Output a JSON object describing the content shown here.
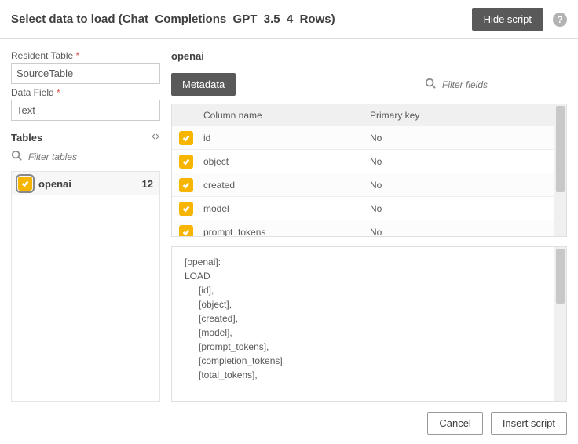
{
  "header": {
    "title": "Select data to load (Chat_Completions_GPT_3.5_4_Rows)",
    "hide_script_btn": "Hide script"
  },
  "left": {
    "resident_label": "Resident Table",
    "resident_value": "SourceTable",
    "datafield_label": "Data Field",
    "datafield_value": "Text",
    "tables_header": "Tables",
    "filter_placeholder": "Filter tables",
    "tables": [
      {
        "name": "openai",
        "count": "12",
        "selected": true
      }
    ]
  },
  "right": {
    "selected_table": "openai",
    "metadata_btn": "Metadata",
    "filter_fields_placeholder": "Filter fields",
    "col_header_name": "Column name",
    "col_header_pk": "Primary key",
    "columns": [
      {
        "name": "id",
        "pk": "No"
      },
      {
        "name": "object",
        "pk": "No"
      },
      {
        "name": "created",
        "pk": "No"
      },
      {
        "name": "model",
        "pk": "No"
      },
      {
        "name": "prompt_tokens",
        "pk": "No"
      }
    ],
    "script_lines": [
      {
        "text": "[openai]:",
        "indent": 0
      },
      {
        "text": "LOAD",
        "indent": 0
      },
      {
        "text": "[id],",
        "indent": 1
      },
      {
        "text": "[object],",
        "indent": 1
      },
      {
        "text": "[created],",
        "indent": 1
      },
      {
        "text": "[model],",
        "indent": 1
      },
      {
        "text": "[prompt_tokens],",
        "indent": 1
      },
      {
        "text": "[completion_tokens],",
        "indent": 1
      },
      {
        "text": "[total_tokens],",
        "indent": 1
      }
    ]
  },
  "footer": {
    "cancel": "Cancel",
    "insert": "Insert script"
  }
}
